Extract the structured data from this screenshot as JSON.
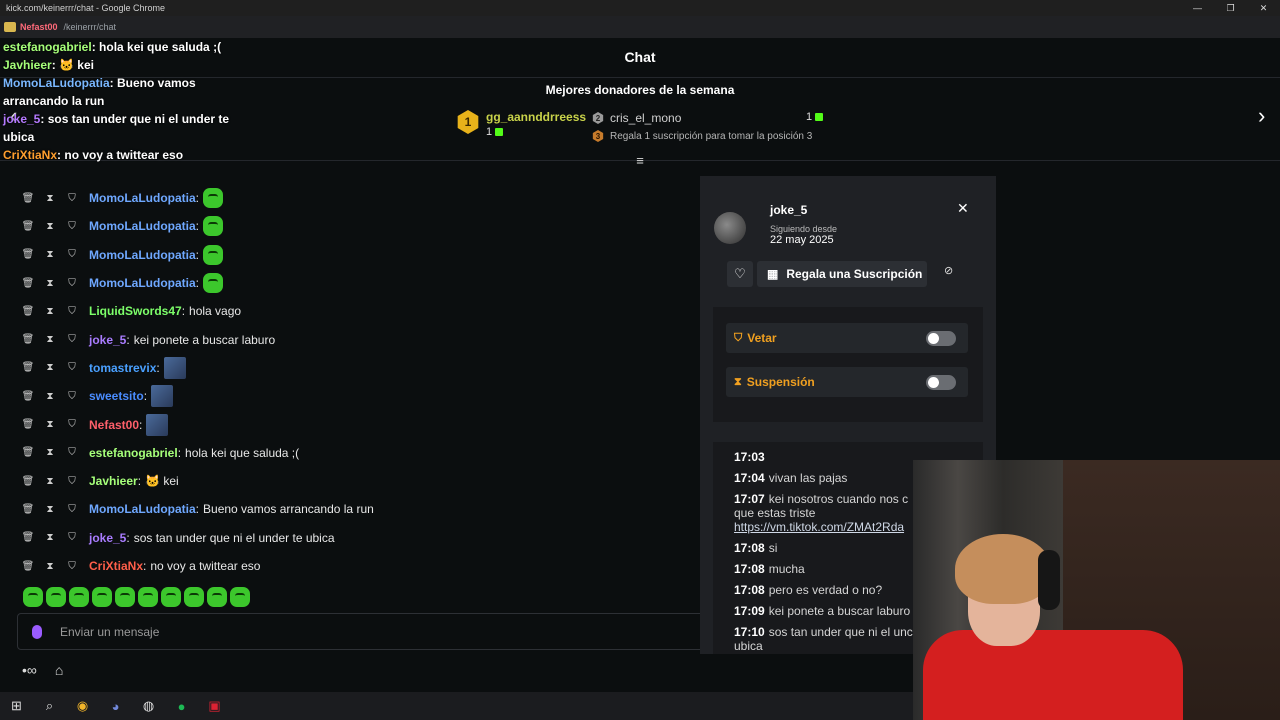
{
  "window": {
    "title": "kick.com/keinerrr/chat - Google Chrome",
    "url": "/keinerrr/chat",
    "tab_user": "Nefast00",
    "min": "—",
    "max": "❐",
    "close": "✕"
  },
  "page": {
    "title": "Chat",
    "donors_title": "Mejores donadores de la semana",
    "donor1_rank": "1",
    "donor1_name": "gg_aannddrreess",
    "donor1_count": "1",
    "donor2_rank": "2",
    "donor2_name": "cris_el_mono",
    "donor2_count": "1",
    "donor3_rank": "3",
    "donor3_text": "Regala 1 suscripción para tomar la posición 3"
  },
  "overlay": [
    {
      "user": "estefanogabriel",
      "text": ": hola kei que saluda ;(",
      "color": "#a6ff7a"
    },
    {
      "user": "Javhieer",
      "text": ": 🐱 kei",
      "color": "#a6ff7a"
    },
    {
      "user": "MomoLaLudopatia",
      "text": ": Bueno vamos arrancando la run",
      "color": "#7ab8ff"
    },
    {
      "user": "joke_5",
      "text": ": sos tan under que ni el under te ubica",
      "color": "#b57aff"
    },
    {
      "user": "CriXtiaNx",
      "text": ": no voy a twittear eso",
      "color": "#ff9f2e"
    }
  ],
  "messages": [
    {
      "user": "MomoLaLudopatia",
      "text": "",
      "color": "#6fa8ff",
      "emote": "green"
    },
    {
      "user": "MomoLaLudopatia",
      "text": "",
      "color": "#6fa8ff",
      "emote": "green"
    },
    {
      "user": "MomoLaLudopatia",
      "text": "",
      "color": "#6fa8ff",
      "emote": "green"
    },
    {
      "user": "MomoLaLudopatia",
      "text": "",
      "color": "#6fa8ff",
      "emote": "green"
    },
    {
      "user": "LiquidSwords47",
      "text": "hola vago",
      "color": "#7dff6a"
    },
    {
      "user": "joke_5",
      "text": "kei ponete a buscar laburo",
      "color": "#a97cff"
    },
    {
      "user": "tomastrevix",
      "text": "",
      "color": "#4aa0ff",
      "emote": "img"
    },
    {
      "user": "sweetsito",
      "text": "",
      "color": "#4a8cff",
      "emote": "img"
    },
    {
      "user": "Nefast00",
      "text": "",
      "color": "#ff5f6a",
      "emote": "img"
    },
    {
      "user": "estefanogabriel",
      "text": "hola kei que saluda ;(",
      "color": "#a6ff7a"
    },
    {
      "user": "Javhieer",
      "text": "🐱 kei",
      "color": "#a6ff7a"
    },
    {
      "user": "MomoLaLudopatia",
      "text": "Bueno vamos arrancando la run",
      "color": "#6fa8ff"
    },
    {
      "user": "joke_5",
      "text": "sos tan under que ni el under te ubica",
      "color": "#a97cff"
    },
    {
      "user": "CriXtiaNx",
      "text": "no voy a twittear eso",
      "color": "#ff5f4a"
    }
  ],
  "input": {
    "placeholder": "Enviar un mensaje"
  },
  "usercard": {
    "name": "joke_5",
    "since_label": "Siguiendo desde",
    "since_date": "22 may 2025",
    "gift_label": "Regala una Suscripción",
    "ban_label": "Vetar",
    "timeout_label": "Suspensión",
    "history": [
      {
        "time": "17:03",
        "text": ""
      },
      {
        "time": "17:04",
        "text": "vivan las pajas"
      },
      {
        "time": "17:07",
        "text": "kei nosotros cuando nos c que estas triste",
        "link": "https://vm.tiktok.com/ZMAt2Rda"
      },
      {
        "time": "17:08",
        "text": "si"
      },
      {
        "time": "17:08",
        "text": "mucha"
      },
      {
        "time": "17:08",
        "text": "pero es verdad o no?"
      },
      {
        "time": "17:09",
        "text": "kei ponete a buscar laburo"
      },
      {
        "time": "17:10",
        "text": "sos tan under que ni el unc ubica"
      }
    ]
  }
}
